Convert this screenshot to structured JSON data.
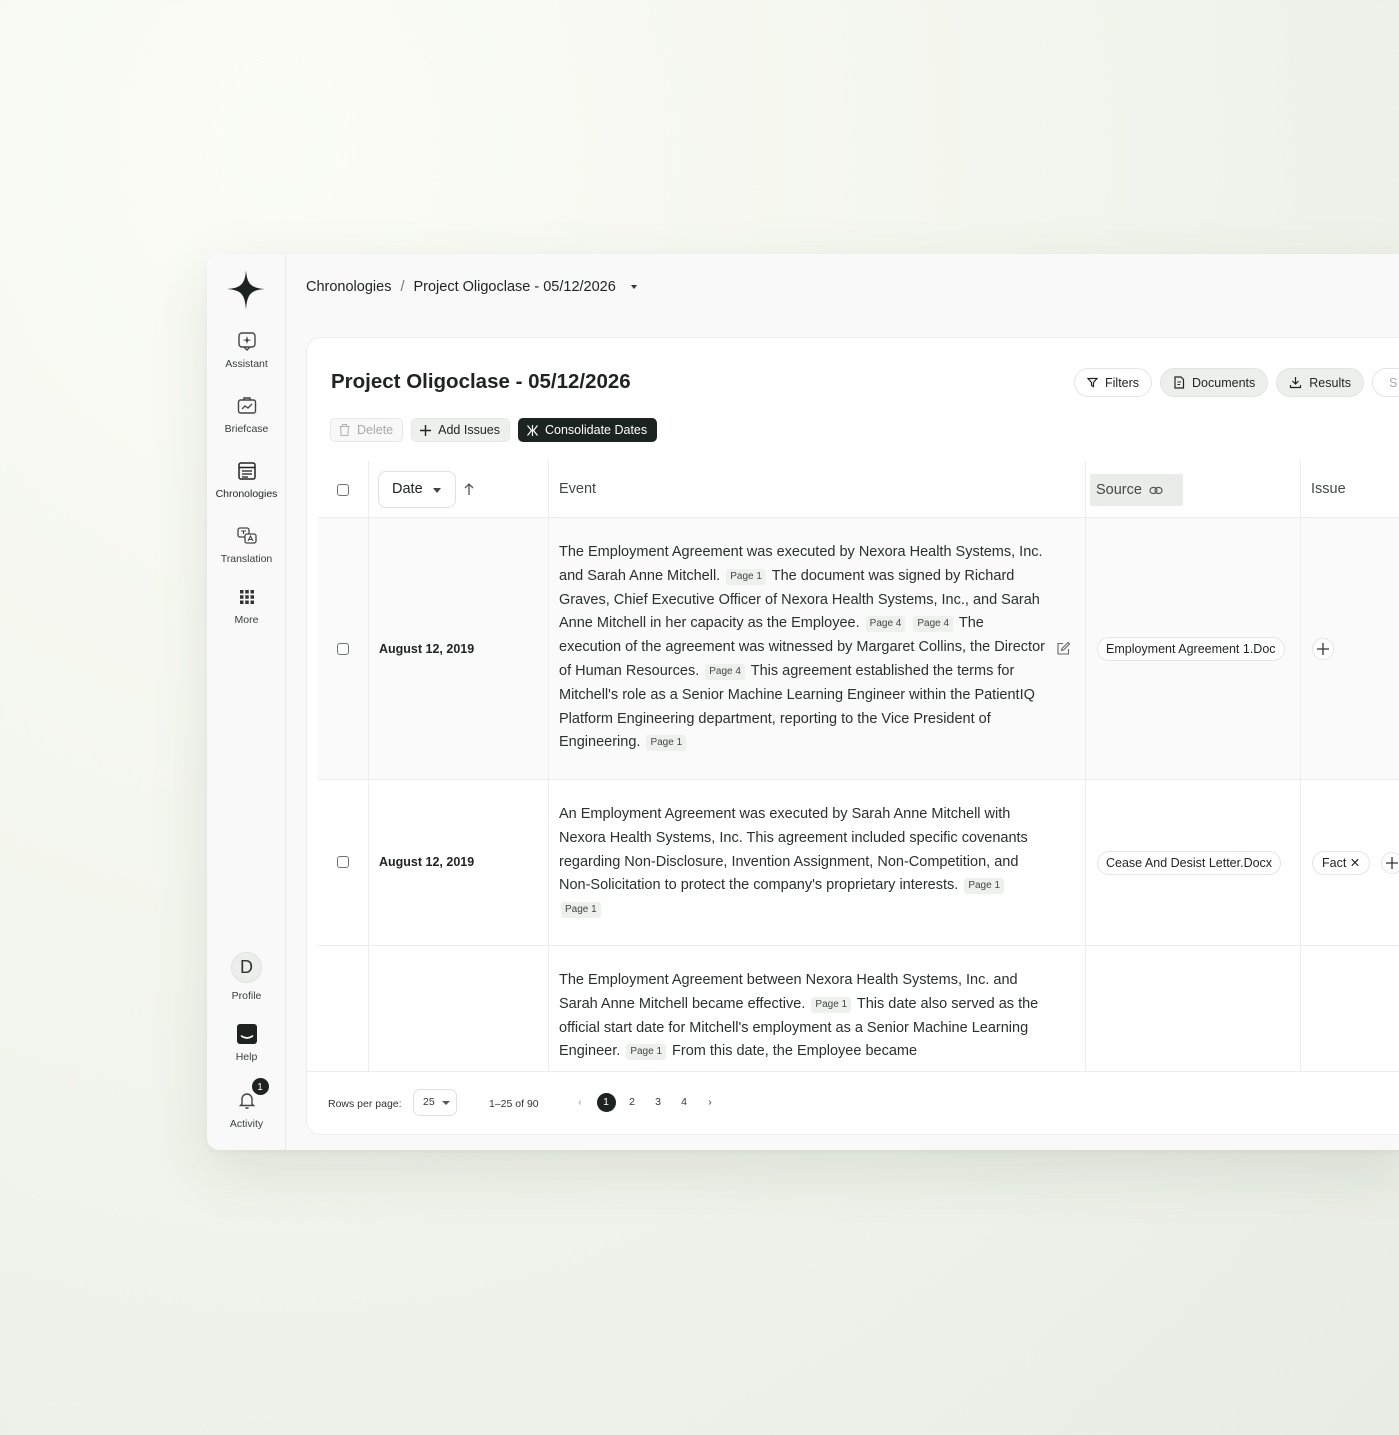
{
  "sidebar": {
    "items": [
      {
        "label": "Assistant",
        "icon": "assistant-icon"
      },
      {
        "label": "Briefcase",
        "icon": "briefcase-icon"
      },
      {
        "label": "Chronologies",
        "icon": "chronologies-icon"
      },
      {
        "label": "Translation",
        "icon": "translation-icon"
      },
      {
        "label": "More",
        "icon": "grid-icon"
      }
    ],
    "bottom": {
      "profile_initial": "D",
      "profile_label": "Profile",
      "help_label": "Help",
      "activity_label": "Activity",
      "activity_count": "1"
    }
  },
  "breadcrumb": {
    "root": "Chronologies",
    "separator": "/",
    "current": "Project Oligoclase - 05/12/2026"
  },
  "page": {
    "title": "Project Oligoclase - 05/12/2026",
    "actions": {
      "filters": "Filters",
      "documents": "Documents",
      "results": "Results",
      "cut_label": "S"
    },
    "toolbar": {
      "delete": "Delete",
      "add_issues": "Add Issues",
      "consolidate": "Consolidate Dates"
    }
  },
  "table": {
    "date_sort_label": "Date",
    "columns": {
      "event": "Event",
      "source": "Source",
      "issue": "Issue"
    },
    "rows": [
      {
        "date": "August 12, 2019",
        "source": "Employment Agreement 1.Doc",
        "event": [
          {
            "t": "The Employment Agreement was executed by Nexora Health Systems, Inc. and Sarah Anne Mitchell."
          },
          {
            "p": "Page 1"
          },
          {
            "t": "The document was signed by Richard Graves, Chief Executive Officer of Nexora Health Systems, Inc., and Sarah Anne Mitchell in her capacity as the Employee."
          },
          {
            "p": "Page 4"
          },
          {
            "p": "Page 4"
          },
          {
            "t": "The execution of the agreement was witnessed by Margaret Collins, the Director of Human Resources."
          },
          {
            "p": "Page 4"
          },
          {
            "t": "This agreement established the terms for Mitchell's role as a Senior Machine Learning Engineer within the PatientIQ Platform Engineering department, reporting to the Vice President of Engineering."
          },
          {
            "p": "Page 1"
          }
        ]
      },
      {
        "date": "August 12, 2019",
        "source": "Cease And Desist Letter.Docx",
        "issue": "Fact",
        "event": [
          {
            "t": "An Employment Agreement was executed by Sarah Anne Mitchell with Nexora Health Systems, Inc. This agreement included specific covenants regarding Non-Disclosure, Invention Assignment, Non-Competition, and Non-Solicitation to protect the company's proprietary interests."
          },
          {
            "p": "Page 1"
          },
          {
            "p": "Page 1"
          }
        ]
      },
      {
        "date": "",
        "source": "",
        "event": [
          {
            "t": "The Employment Agreement between Nexora Health Systems, Inc. and Sarah Anne Mitchell became effective."
          },
          {
            "p": "Page 1"
          },
          {
            "t": "This date also served as the official start date for Mitchell's employment as a Senior Machine Learning Engineer."
          },
          {
            "p": "Page 1"
          },
          {
            "t": "From this date, the Employee became"
          }
        ]
      }
    ]
  },
  "pagination": {
    "rows_per_page_label": "Rows per page:",
    "rows_per_page": "25",
    "range": "1–25 of 90",
    "pages": [
      "1",
      "2",
      "3",
      "4"
    ],
    "current_page": "1",
    "prev": "‹",
    "next": "›"
  }
}
